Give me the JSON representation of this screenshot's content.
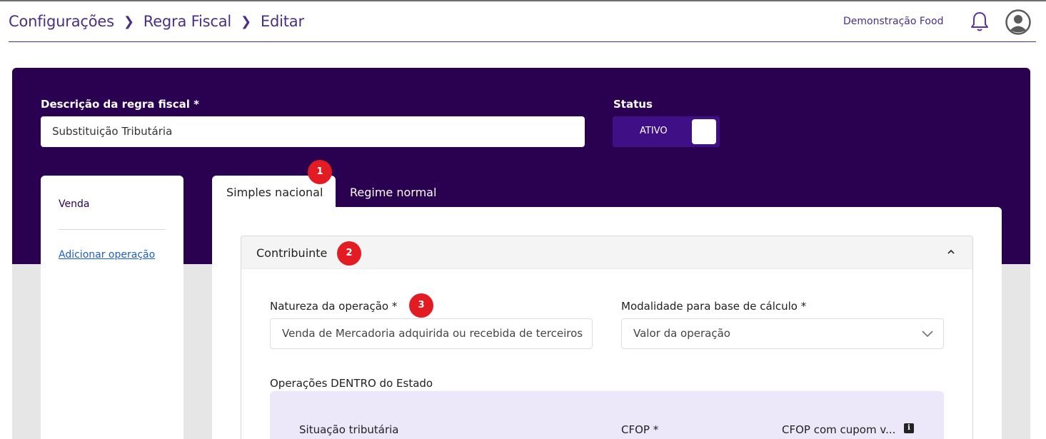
{
  "header": {
    "breadcrumb": [
      "Configurações",
      "Regra Fiscal",
      "Editar"
    ],
    "company": "Demonstração Food",
    "icons": [
      "bell-icon",
      "user-avatar-icon"
    ]
  },
  "form": {
    "description_label": "Descrição da regra fiscal *",
    "description_value": "Substituição Tributária",
    "status_label": "Status",
    "status_value": "ATIVO"
  },
  "sidebar": {
    "items": [
      {
        "label": "Venda"
      }
    ],
    "add_label": "Adicionar operação"
  },
  "tabs": [
    {
      "label": "Simples nacional",
      "active": true
    },
    {
      "label": "Regime normal",
      "active": false
    }
  ],
  "badges": [
    "1",
    "2",
    "3"
  ],
  "section": {
    "title": "Contribuinte",
    "natureza_label": "Natureza da operação *",
    "natureza_value": "Venda de Mercadoria adquirida ou recebida de terceiros",
    "modalidade_label": "Modalidade para base de cálculo *",
    "modalidade_value": "Valor da operação",
    "inside_state_label": "Operações DENTRO do Estado",
    "columns": [
      "Situação tributária",
      "CFOP *",
      "CFOP com cupom v..."
    ]
  },
  "colors": {
    "brand_purple": "#2a0050",
    "toggle_purple": "#3f0f86",
    "badge_red": "#e31b23",
    "link_blue": "#1a5fd6",
    "lavender": "#ece8fa"
  }
}
